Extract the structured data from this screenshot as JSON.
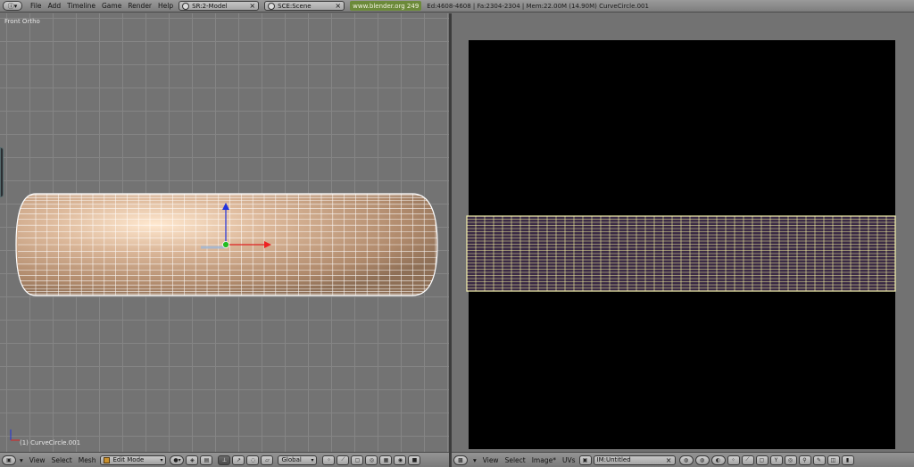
{
  "top_header": {
    "editor_type_icon": "info-editor-icon",
    "menus": [
      "File",
      "Add",
      "Timeline",
      "Game",
      "Render",
      "Help"
    ],
    "screen_field": "SR:2-Model",
    "scene_field": "SCE:Scene",
    "website": "www.blender.org 249",
    "stats": "Ed:4608-4608 | Fa:2304-2304 | Mem:22.00M (14.90M) CurveCircle.001"
  },
  "viewport": {
    "view_label": "Front Ortho",
    "object_label": "(1) CurveCircle.001",
    "colors": {
      "background": "#737373",
      "grid": "#858585",
      "mesh": "#d8b89a",
      "wire": "#ffffff"
    },
    "header": {
      "menus": [
        "View",
        "Select",
        "Mesh"
      ],
      "mode": "Edit Mode",
      "orientation": "Global"
    }
  },
  "image_editor": {
    "colors": {
      "background": "#727272",
      "canvas": "#000000",
      "uv_wire": "#f5f2a0",
      "uv_fill": "#3a2a45"
    },
    "header": {
      "menus": [
        "View",
        "Select",
        "Image*",
        "UVs"
      ],
      "image_name": "IM:Untitled"
    }
  }
}
